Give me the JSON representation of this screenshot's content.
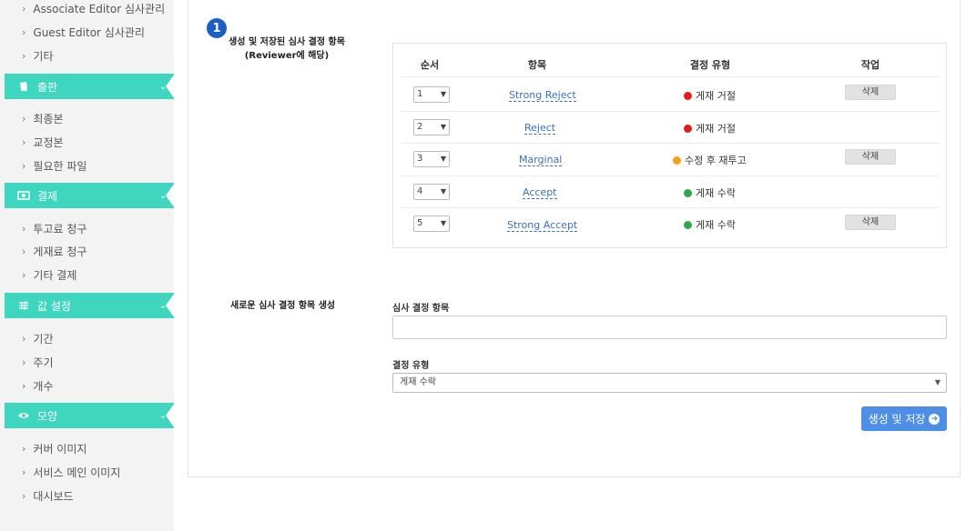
{
  "sidebar": {
    "groups": [
      {
        "items": [
          "Associate Editor 심사관리",
          "Guest Editor 심사관리",
          "기타"
        ]
      },
      {
        "title": "출판",
        "icon": "book-icon",
        "items": [
          "최종본",
          "교정본",
          "필요한 파일"
        ]
      },
      {
        "title": "결제",
        "icon": "money-icon",
        "items": [
          "투고료 청구",
          "게재료 청구",
          "기타 결제"
        ]
      },
      {
        "title": "값 설정",
        "icon": "sliders-icon",
        "items": [
          "기간",
          "주기",
          "개수"
        ]
      },
      {
        "title": "모양",
        "icon": "eye-icon",
        "items": [
          "커버 이미지",
          "서비스 메인 이미지",
          "대시보드"
        ]
      }
    ]
  },
  "saved": {
    "badge": "1",
    "label_line1": "생성 및 저장된 심사 결정 항목",
    "label_line2": "(Reviewer에 해당)",
    "headers": {
      "order": "순서",
      "item": "항목",
      "type": "결정 유형",
      "action": "작업"
    },
    "rows": [
      {
        "order": "1",
        "item": "Strong Reject",
        "type": "게재 거절",
        "color": "#e21b1b",
        "action": "삭제"
      },
      {
        "order": "2",
        "item": "Reject",
        "type": "게재 거절",
        "color": "#e21b1b",
        "action": ""
      },
      {
        "order": "3",
        "item": "Marginal",
        "type": "수정 후 재투고",
        "color": "#f5a01a",
        "action": "삭제"
      },
      {
        "order": "4",
        "item": "Accept",
        "type": "게재 수락",
        "color": "#2ea84a",
        "action": ""
      },
      {
        "order": "5",
        "item": "Strong Accept",
        "type": "게재 수락",
        "color": "#2ea84a",
        "action": "삭제"
      }
    ]
  },
  "new_item": {
    "label": "새로운 심사 결정 항목 생성",
    "field_label": "심사 결정 항목",
    "field_value": "",
    "type_label": "결정 유형",
    "type_value": "게재 수락",
    "save_label": "생성 및 저장"
  },
  "colors": {
    "accent": "#3fd6c0",
    "primary": "#4d8fe6",
    "link": "#3a6fc4"
  }
}
